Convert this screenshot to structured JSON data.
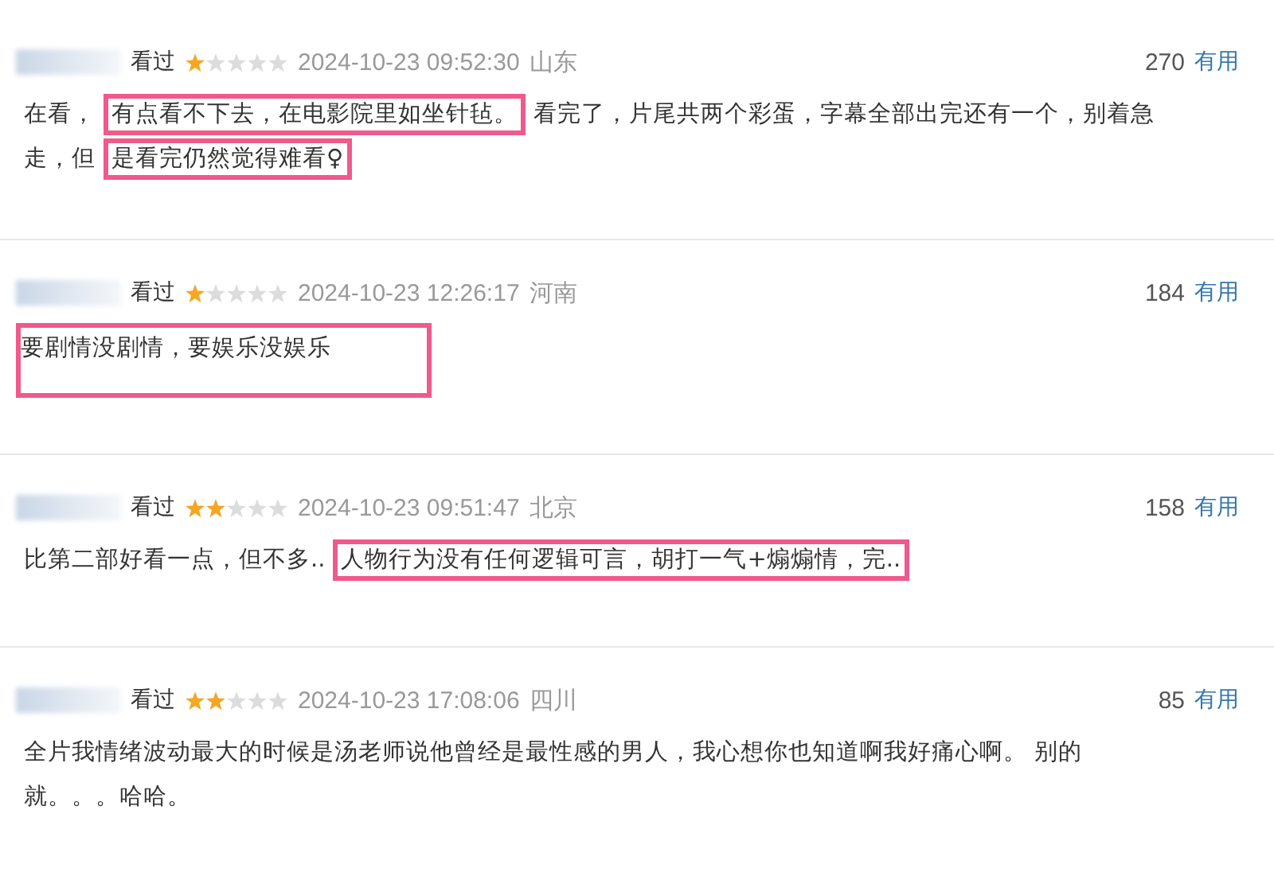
{
  "reviews": [
    {
      "status": "看过",
      "stars": 1,
      "time": "2024-10-23 09:52:30",
      "location": "山东",
      "votes": "270",
      "vote_label": "有用",
      "lines": [
        [
          {
            "text": "在看，",
            "highlighted": false
          },
          {
            "text": "有点看不下去，在电影院里如坐针毡。",
            "highlighted": true
          },
          {
            "text": " 看完了，片尾共两个彩蛋，字幕全部出完还有一个，别着急",
            "highlighted": false
          }
        ],
        [
          {
            "text": "走，但",
            "highlighted": false
          },
          {
            "text": "是看完仍然觉得难看♀",
            "highlighted": true
          }
        ]
      ]
    },
    {
      "status": "看过",
      "stars": 1,
      "time": "2024-10-23 12:26:17",
      "location": "河南",
      "votes": "184",
      "vote_label": "有用",
      "lines": [
        [
          {
            "text": "要剧情没剧情，要娱乐没娱乐",
            "highlighted": true
          }
        ]
      ]
    },
    {
      "status": "看过",
      "stars": 2,
      "time": "2024-10-23 09:51:47",
      "location": "北京",
      "votes": "158",
      "vote_label": "有用",
      "lines": [
        [
          {
            "text": "比第二部好看一点，但不多..",
            "highlighted": false
          },
          {
            "text": "人物行为没有任何逻辑可言，胡打一气+煽煽情，完..",
            "highlighted": true
          }
        ]
      ]
    },
    {
      "status": "看过",
      "stars": 2,
      "time": "2024-10-23 17:08:06",
      "location": "四川",
      "votes": "85",
      "vote_label": "有用",
      "lines": [
        [
          {
            "text": "全片我情绪波动最大的时候是汤老师说他曾经是最性感的男人，我心想你也知道啊我好痛心啊。 别的",
            "highlighted": false
          }
        ],
        [
          {
            "text": "就。。。哈哈。",
            "highlighted": false
          }
        ]
      ]
    }
  ]
}
